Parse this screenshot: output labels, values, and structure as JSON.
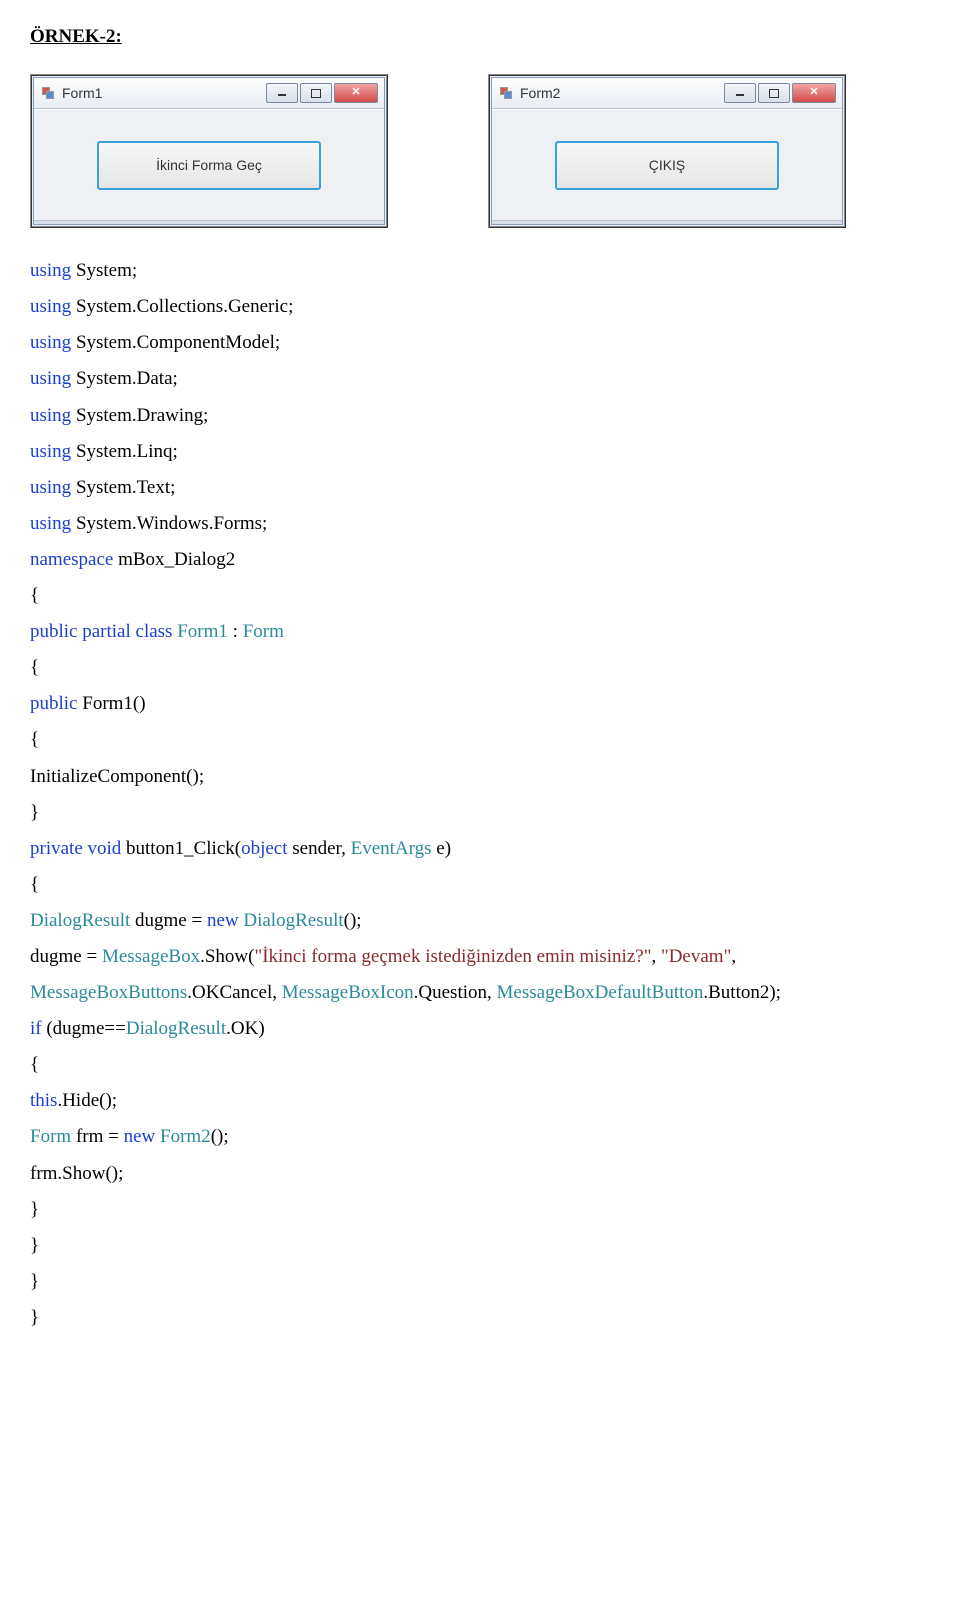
{
  "heading": "ÖRNEK-2:",
  "form1": {
    "title": "Form1",
    "button": "İkinci Forma Geç"
  },
  "form2": {
    "title": "Form2",
    "button": "ÇIKIŞ"
  },
  "L1_a": "using",
  "L1_b": " System;",
  "L2_a": "using",
  "L2_b": " System.Collections.Generic;",
  "L3_a": "using",
  "L3_b": " System.ComponentModel;",
  "L4_a": "using",
  "L4_b": " System.Data;",
  "L5_a": "using",
  "L5_b": " System.Drawing;",
  "L6_a": "using",
  "L6_b": " System.Linq;",
  "L7_a": "using",
  "L7_b": " System.Text;",
  "L8_a": "using",
  "L8_b": " System.Windows.Forms;",
  "L9_a": "namespace",
  "L9_b": " mBox_Dialog2",
  "L10": "{",
  "L11_a": "public partial class ",
  "L11_b": "Form1",
  "L11_c": " : ",
  "L11_d": "Form",
  "L12": "{",
  "L13_a": "public",
  "L13_b": " Form1()",
  "L14": "{",
  "L15": "InitializeComponent();",
  "L16": "}",
  "L17_a": "private void",
  "L17_b": " button1_Click(",
  "L17_c": "object",
  "L17_d": " sender, ",
  "L17_e": "EventArgs",
  "L17_f": " e)",
  "L18": "{",
  "L19_a": "DialogResult",
  "L19_b": " dugme = ",
  "L19_c": "new ",
  "L19_d": "DialogResult",
  "L19_e": "();",
  "L20_a": "dugme = ",
  "L20_b": "MessageBox",
  "L20_c": ".Show(",
  "L20_d": "\"İkinci forma geçmek istediğinizden emin misiniz?\"",
  "L20_e": ", ",
  "L20_f": "\"Devam\"",
  "L20_g": ",",
  "L21_a": "MessageBoxButtons",
  "L21_b": ".OKCancel, ",
  "L21_c": "MessageBoxIcon",
  "L21_d": ".Question, ",
  "L21_e": "MessageBoxDefaultButton",
  "L21_f": ".Button2);",
  "L22_a": "if ",
  "L22_b": "(dugme==",
  "L22_c": "DialogResult",
  "L22_d": ".OK)",
  "L23": "{",
  "L24_a": "this",
  "L24_b": ".Hide();",
  "L25_a": "Form",
  "L25_b": " frm = ",
  "L25_c": "new ",
  "L25_d": "Form2",
  "L25_e": "();",
  "L26": "frm.Show();",
  "L27": "}",
  "L28": "}",
  "L29": "}",
  "L30": "}"
}
